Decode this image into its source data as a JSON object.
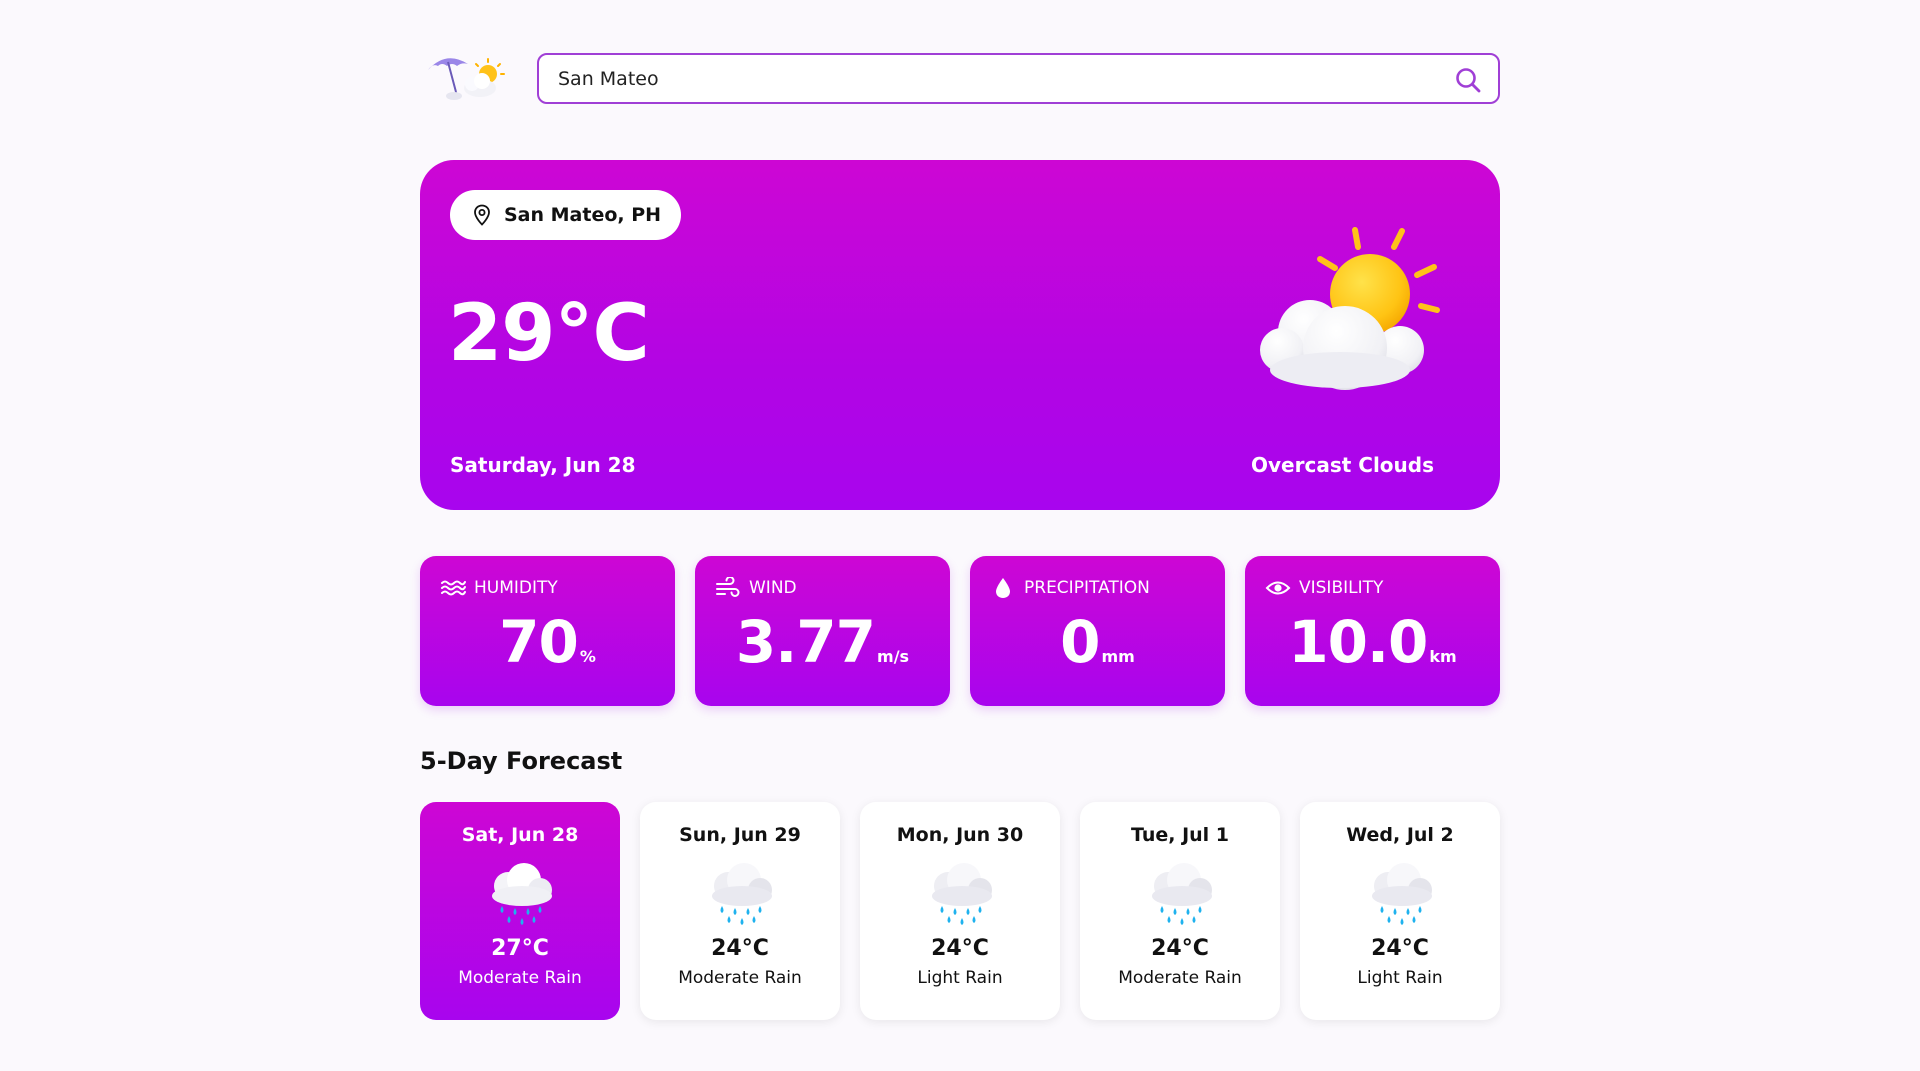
{
  "search": {
    "value": "San Mateo",
    "placeholder": ""
  },
  "current": {
    "location": "San Mateo, PH",
    "temperature": "29°C",
    "date": "Saturday, Jun 28",
    "condition": "Overcast Clouds"
  },
  "stats": [
    {
      "label": "Humidity",
      "value": "70",
      "unit": "%",
      "icon": "humidity-icon"
    },
    {
      "label": "Wind",
      "value": "3.77",
      "unit": "m/s",
      "icon": "wind-icon"
    },
    {
      "label": "Precipitation",
      "value": "0",
      "unit": "mm",
      "icon": "droplet-icon"
    },
    {
      "label": "Visibility",
      "value": "10.0",
      "unit": "km",
      "icon": "eye-icon"
    }
  ],
  "forecast": {
    "title": "5-Day Forecast",
    "days": [
      {
        "day": "Sat, Jun 28",
        "temp": "27°C",
        "desc": "Moderate Rain",
        "active": true
      },
      {
        "day": "Sun, Jun 29",
        "temp": "24°C",
        "desc": "Moderate Rain",
        "active": false
      },
      {
        "day": "Mon, Jun 30",
        "temp": "24°C",
        "desc": "Light Rain",
        "active": false
      },
      {
        "day": "Tue, Jul 1",
        "temp": "24°C",
        "desc": "Moderate Rain",
        "active": false
      },
      {
        "day": "Wed, Jul 2",
        "temp": "24°C",
        "desc": "Light Rain",
        "active": false
      }
    ]
  },
  "colors": {
    "accent_start": "#cd06d4",
    "accent_end": "#a805ee",
    "search_border": "#a03fd6",
    "background": "#fbf9fd"
  }
}
